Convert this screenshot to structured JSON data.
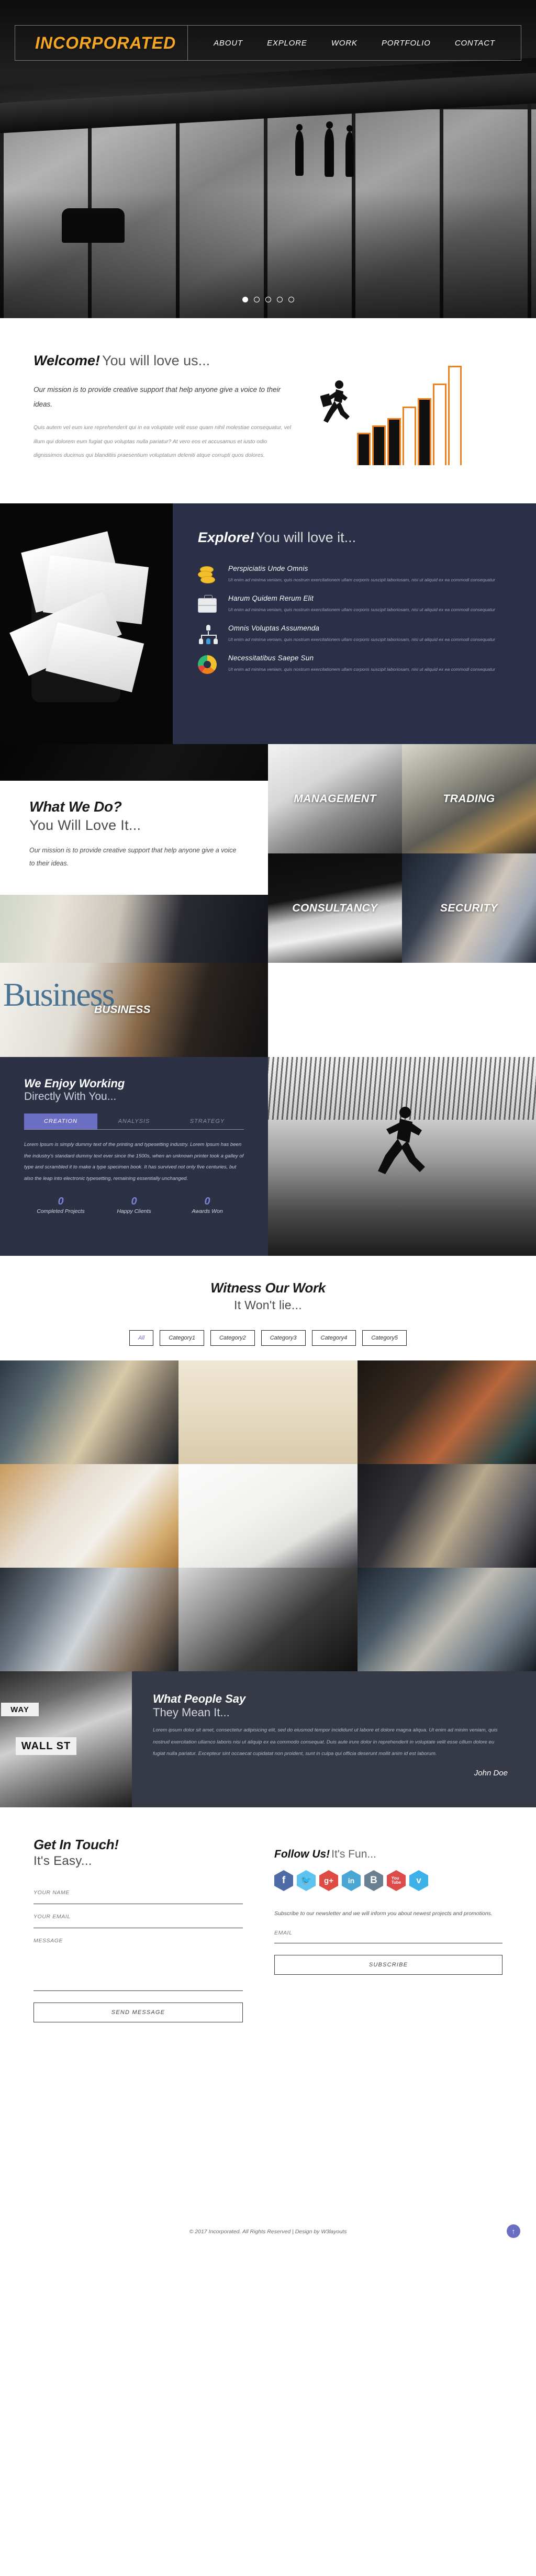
{
  "nav": {
    "brand": "INCORPORATED",
    "links": [
      "ABOUT",
      "EXPLORE",
      "WORK",
      "PORTFOLIO",
      "CONTACT"
    ]
  },
  "hero": {
    "slides": 5,
    "active_slide": 1
  },
  "welcome": {
    "title_bold": "Welcome!",
    "title_light": "You will love us...",
    "lead": "Our mission is to provide creative support that help anyone give a voice to their ideas.",
    "body": "Quis autem vel eum iure reprehenderit qui in ea voluptate velit esse quam nihil molestiae consequatur, vel illum qui dolorem eum fugiat quo voluptas nulla pariatur? At vero eos et accusamus et iusto odio dignissimos ducimus qui blanditiis praesentium voluptatum deleniti atque corrupti quos dolores."
  },
  "explore": {
    "title_bold": "Explore!",
    "title_light": "You will love it...",
    "features": [
      {
        "icon": "coins-icon",
        "title": "Perspiciatis Unde Omnis",
        "text": "Ut enim ad minima veniam, quis nostrum exercitationem ullam corporis suscipit laboriosam, nisi ut aliquid ex ea commodi consequatur"
      },
      {
        "icon": "briefcase-icon",
        "title": "Harum Quidem Rerum Elit",
        "text": "Ut enim ad minima veniam, quis nostrum exercitationem ullam corporis suscipit laboriosam, nisi ut aliquid ex ea commodi consequatur"
      },
      {
        "icon": "org-chart-icon",
        "title": "Omnis Voluptas Assumenda",
        "text": "Ut enim ad minima veniam, quis nostrum exercitationem ullam corporis suscipit laboriosam, nisi ut aliquid ex ea commodi consequatur"
      },
      {
        "icon": "donut-chart-icon",
        "title": "Necessitatibus Saepe Sun",
        "text": "Ut enim ad minima veniam, quis nostrum exercitationem ullam corporis suscipit laboriosam, nisi ut aliquid ex ea commodi consequatur"
      }
    ]
  },
  "services": {
    "title_bold": "What We Do?",
    "title_light": "You Will Love It...",
    "intro": "Our mission is to provide creative support that help anyone give a voice to their ideas.",
    "tiles": [
      "MANAGEMENT",
      "TRADING",
      "BUSINESS",
      "CONSULTANCY",
      "SECURITY"
    ],
    "business_overlay_word": "Business"
  },
  "work": {
    "title_bold": "We Enjoy Working",
    "title_light": "Directly With You...",
    "tabs": [
      "CREATION",
      "ANALYSIS",
      "STRATEGY"
    ],
    "active_tab": "CREATION",
    "body": "Lorem Ipsum is simply dummy text of the printing and typesetting industry. Lorem Ipsum has been the industry's standard dummy text ever since the 1500s, when an unknown printer took a galley of type and scrambled it to make a type specimen book. It has survived not only five centuries, but also the leap into electronic typesetting, remaining essentially unchanged.",
    "counters": [
      {
        "value": "0",
        "label": "Completed Projects"
      },
      {
        "value": "0",
        "label": "Happy Clients"
      },
      {
        "value": "0",
        "label": "Awards Won"
      }
    ]
  },
  "portfolio": {
    "title_bold": "Witness Our Work",
    "title_light": "It Won't lie...",
    "filters": [
      "All",
      "Category1",
      "Category2",
      "Category3",
      "Category4",
      "Category5"
    ],
    "active_filter": "All",
    "gallery_count": 9
  },
  "testimonial": {
    "title_bold": "What People Say",
    "title_light": "They Mean It...",
    "quote": "Lorem ipsum dolor sit amet, consectetur adipisicing elit, sed do eiusmod tempor incididunt ut labore et dolore magna aliqua. Ut enim ad minim veniam, quis nostrud exercitation ullamco laboris nisi ut aliquip ex ea commodo consequat. Duis aute irure dolor in reprehenderit in voluptate velit esse cillum dolore eu fugiat nulla pariatur. Excepteur sint occaecat cupidatat non proident, sunt in culpa qui officia deserunt mollit anim id est laborum.",
    "author": "John Doe",
    "sign_small": "WAY",
    "sign_large": "WALL ST"
  },
  "contact": {
    "title_bold": "Get In Touch!",
    "title_light": "It's Easy...",
    "fields": [
      {
        "label": "YOUR NAME",
        "value": ""
      },
      {
        "label": "YOUR EMAIL",
        "value": ""
      },
      {
        "label": "MESSAGE",
        "value": ""
      }
    ],
    "submit_label": "SEND MESSAGE"
  },
  "follow": {
    "title_bold": "Follow Us!",
    "title_light": "It's Fun...",
    "socials": [
      {
        "name": "facebook-icon",
        "glyph": "f",
        "color": "#4f6ba5"
      },
      {
        "name": "twitter-icon",
        "glyph": "ᵛ",
        "color": "#5ec3ef"
      },
      {
        "name": "google-plus-icon",
        "glyph": "g+",
        "color": "#dd4b43"
      },
      {
        "name": "linkedin-icon",
        "glyph": "in",
        "color": "#4aa7d4"
      },
      {
        "name": "blogger-icon",
        "glyph": "B",
        "color": "#6b7f93"
      },
      {
        "name": "youtube-icon",
        "glyph": "You",
        "color": "#de4b4b"
      },
      {
        "name": "vimeo-icon",
        "glyph": "v",
        "color": "#3eb2e8"
      }
    ]
  },
  "newsletter": {
    "note": "Subscribe to our newsletter and we will inform you about newest projects and promotions.",
    "email_label": "EMAIL",
    "email_value": "",
    "submit_label": "SUBSCRIBE"
  },
  "footer": {
    "copyright": "© 2017 Incorporated. All Rights Reserved | Design by W3layouts",
    "to_top": "↑"
  },
  "colors": {
    "brand_yellow": "#f5a623",
    "navy": "#2b3048",
    "accent_purple": "#6b6fc4",
    "dark_slate": "#363a47"
  }
}
